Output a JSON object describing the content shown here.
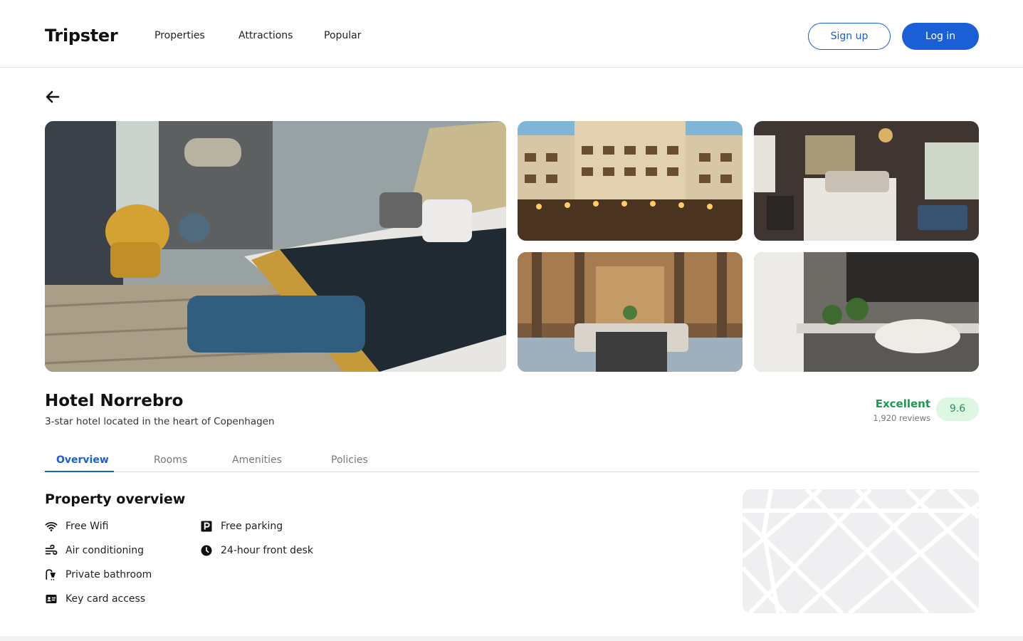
{
  "header": {
    "logo": "Tripster",
    "nav": [
      {
        "label": "Properties"
      },
      {
        "label": "Attractions"
      },
      {
        "label": "Popular"
      }
    ],
    "signup_label": "Sign up",
    "login_label": "Log in"
  },
  "hotel": {
    "name": "Hotel Norrebro",
    "description": "3-star hotel located in the heart of Copenhagen",
    "rating_label": "Excellent",
    "reviews": "1,920 reviews",
    "score": "9.6"
  },
  "gallery": [
    {
      "subject": "hotel bedroom with bed and yellow armchairs"
    },
    {
      "subject": "grand hotel facade at dusk"
    },
    {
      "subject": "dark modern bedroom"
    },
    {
      "subject": "ornate hotel lobby lounge"
    },
    {
      "subject": "bathroom sink with plants"
    }
  ],
  "tabs": [
    {
      "label": "Overview",
      "active": true
    },
    {
      "label": "Rooms"
    },
    {
      "label": "Amenities"
    },
    {
      "label": "Policies"
    }
  ],
  "overview": {
    "title": "Property overview",
    "amenities": [
      {
        "label": "Free Wifi",
        "icon": "wifi-icon"
      },
      {
        "label": "Air conditioning",
        "icon": "air-conditioning-icon"
      },
      {
        "label": "Private bathroom",
        "icon": "shower-icon"
      },
      {
        "label": "Key card access",
        "icon": "key-card-icon"
      },
      {
        "label": "Free parking",
        "icon": "parking-icon"
      },
      {
        "label": "24-hour front desk",
        "icon": "clock-icon"
      }
    ]
  },
  "colors": {
    "accent": "#1a5fd6",
    "rating_green": "#1c9a4f",
    "score_bg": "#ddf7e3"
  }
}
